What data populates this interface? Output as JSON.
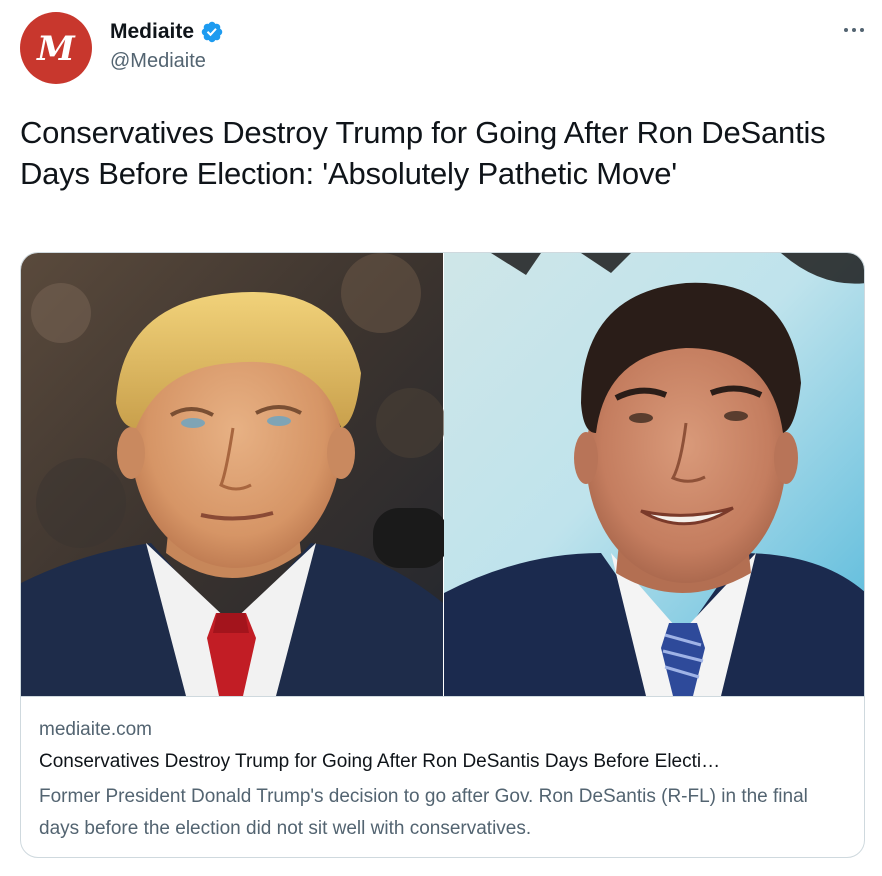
{
  "account": {
    "avatar_letter": "M",
    "display_name": "Mediaite",
    "handle": "@Mediaite",
    "verified": true
  },
  "tweet": {
    "text": "Conservatives Destroy Trump for Going After Ron DeSantis Days Before Election: 'Absolutely Pathetic Move'"
  },
  "card": {
    "domain": "mediaite.com",
    "title": "Conservatives Destroy Trump for Going After Ron DeSantis Days Before Electi…",
    "description": "Former President Donald Trump's decision to go after Gov. Ron DeSantis (R-FL) in the final days before the election did not sit well with conservatives."
  },
  "icons": {
    "verified": "verified-badge-icon",
    "more": "more-options-icon"
  },
  "colors": {
    "avatar_bg": "#c8372d",
    "verified_blue": "#1d9bf0",
    "text_primary": "#0f1419",
    "text_secondary": "#536471",
    "border": "#cfd9de"
  }
}
